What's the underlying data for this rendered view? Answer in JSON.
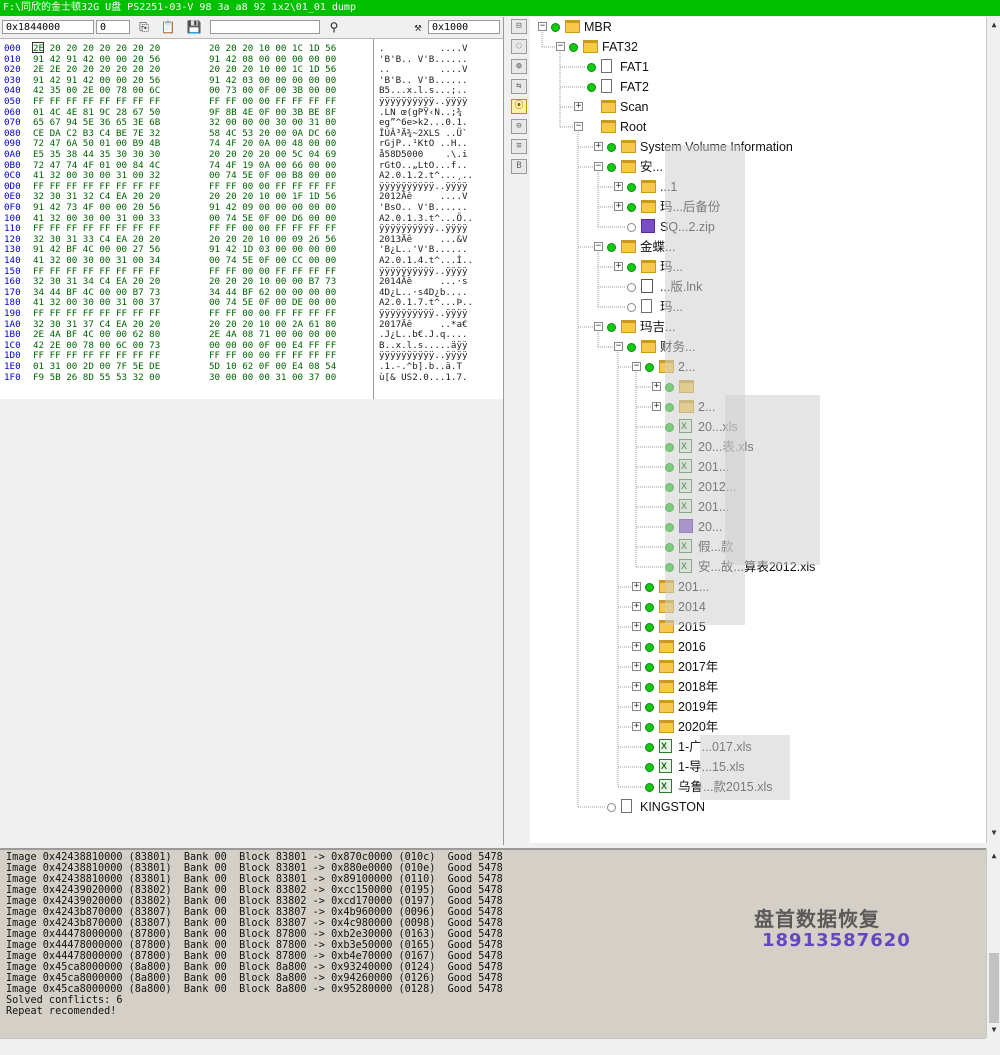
{
  "window": {
    "title": "F:\\同欣的金士顿32G U盘 PS2251-03-V   98 3a a8 92   1x2\\01_01 dump"
  },
  "toolbar": {
    "address": "0x1844000",
    "offset_value": "0",
    "copy_icon": "copy-icon",
    "paste_icon": "paste-icon",
    "save_icon": "save-icon",
    "find_icon": "binoculars-icon",
    "tools_icon": "tools-icon",
    "jump_value": "0x1000"
  },
  "hex": {
    "rows": [
      {
        "off": "000",
        "b1": "2E 20 20 20 20 20 20 20",
        "b2": "20 20 20 10 00 1C 1D 56",
        "asc": ".          ....V"
      },
      {
        "off": "010",
        "b1": "91 42 91 42 00 00 20 56",
        "b2": "91 42 08 00 00 00 00 00",
        "asc": "'B'B.. V'B......"
      },
      {
        "off": "020",
        "b1": "2E 2E 20 20 20 20 20 20",
        "b2": "20 20 20 10 00 1C 1D 56",
        "asc": "..         ....V"
      },
      {
        "off": "030",
        "b1": "91 42 91 42 00 00 20 56",
        "b2": "91 42 03 00 00 00 00 00",
        "asc": "'B'B.. V'B......"
      },
      {
        "off": "040",
        "b1": "42 35 00 2E 00 78 00 6C",
        "b2": "00 73 00 0F 00 3B 00 00",
        "asc": "B5...x.l.s...;.."
      },
      {
        "off": "050",
        "b1": "FF FF FF FF FF FF FF FF",
        "b2": "FF FF 00 00 FF FF FF FF",
        "asc": "ÿÿÿÿÿÿÿÿÿÿ..ÿÿÿÿ"
      },
      {
        "off": "060",
        "b1": "01 4C 4E 81 9C 28 67 50",
        "b2": "9F 8B 4E 0F 00 3B BE 8F",
        "asc": ".LN œ(gPŸ‹N..;¾"
      },
      {
        "off": "070",
        "b1": "65 67 94 5E 36 65 3E 6B",
        "b2": "32 00 00 00 30 00 31 00",
        "asc": "eg”^6e>k2...0.1."
      },
      {
        "off": "080",
        "b1": "CE DA C2 B3 C4 BE 7E 32",
        "b2": "58 4C 53 20 00 0A DC 60",
        "asc": "ÎÚÂ³Ä¾~2XLS ..Ü`"
      },
      {
        "off": "090",
        "b1": "72 47 6A 50 01 00 B9 4B",
        "b2": "74 4F 20 0A 00 48 00 00",
        "asc": "rGjP..¹KtO ..H.."
      },
      {
        "off": "0A0",
        "b1": "E5 35 38 44 35 30 30 30",
        "b2": "20 20 20 20 00 5C 04 69",
        "asc": "å58D5000    .\\.i"
      },
      {
        "off": "0B0",
        "b1": "72 47 74 4F 01 00 84 4C",
        "b2": "74 4F 19 0A 00 66 00 00",
        "asc": "rGtO..„LtO...f.."
      },
      {
        "off": "0C0",
        "b1": "41 32 00 30 00 31 00 32",
        "b2": "00 74 5E 0F 00 B8 00 00",
        "asc": "A2.0.1.2.t^...¸.."
      },
      {
        "off": "0D0",
        "b1": "FF FF FF FF FF FF FF FF",
        "b2": "FF FF 00 00 FF FF FF FF",
        "asc": "ÿÿÿÿÿÿÿÿÿÿ..ÿÿÿÿ"
      },
      {
        "off": "0E0",
        "b1": "32 30 31 32 C4 EA 20 20",
        "b2": "20 20 20 10 00 1F 1D 56",
        "asc": "2012Äê     ....V"
      },
      {
        "off": "0F0",
        "b1": "91 42 73 4F 00 00 20 56",
        "b2": "91 42 09 00 00 00 00 00",
        "asc": "'BsO.. V'B......"
      },
      {
        "off": "100",
        "b1": "41 32 00 30 00 31 00 33",
        "b2": "00 74 5E 0F 00 D6 00 00",
        "asc": "A2.0.1.3.t^...Ö.."
      },
      {
        "off": "110",
        "b1": "FF FF FF FF FF FF FF FF",
        "b2": "FF FF 00 00 FF FF FF FF",
        "asc": "ÿÿÿÿÿÿÿÿÿÿ..ÿÿÿÿ"
      },
      {
        "off": "120",
        "b1": "32 30 31 33 C4 EA 20 20",
        "b2": "20 20 20 10 00 09 26 56",
        "asc": "2013Äê     ...&V"
      },
      {
        "off": "130",
        "b1": "91 42 BF 4C 00 00 27 56",
        "b2": "91 42 1D 03 00 00 00 00",
        "asc": "'B¿L..'V'B......"
      },
      {
        "off": "140",
        "b1": "41 32 00 30 00 31 00 34",
        "b2": "00 74 5E 0F 00 CC 00 00",
        "asc": "A2.0.1.4.t^...Ì.."
      },
      {
        "off": "150",
        "b1": "FF FF FF FF FF FF FF FF",
        "b2": "FF FF 00 00 FF FF FF FF",
        "asc": "ÿÿÿÿÿÿÿÿÿÿ..ÿÿÿÿ"
      },
      {
        "off": "160",
        "b1": "32 30 31 34 C4 EA 20 20",
        "b2": "20 20 20 10 00 00 B7 73",
        "asc": "2014Äê     ...·s"
      },
      {
        "off": "170",
        "b1": "34 44 BF 4C 00 00 B7 73",
        "b2": "34 44 BF 62 00 00 00 00",
        "asc": "4D¿L..·s4D¿b...."
      },
      {
        "off": "180",
        "b1": "41 32 00 30 00 31 00 37",
        "b2": "00 74 5E 0F 00 DE 00 00",
        "asc": "A2.0.1.7.t^...Þ.."
      },
      {
        "off": "190",
        "b1": "FF FF FF FF FF FF FF FF",
        "b2": "FF FF 00 00 FF FF FF FF",
        "asc": "ÿÿÿÿÿÿÿÿÿÿ..ÿÿÿÿ"
      },
      {
        "off": "1A0",
        "b1": "32 30 31 37 C4 EA 20 20",
        "b2": "20 20 20 10 00 2A 61 80",
        "asc": "2017Äê     ..*a€"
      },
      {
        "off": "1B0",
        "b1": "2E 4A BF 4C 00 00 62 80",
        "b2": "2E 4A 08 71 00 00 00 00",
        "asc": ".J¿L..b€.J.q...."
      },
      {
        "off": "1C0",
        "b1": "42 2E 00 78 00 6C 00 73",
        "b2": "00 00 00 0F 00 E4 FF FF",
        "asc": "B..x.l.s.....äÿÿ"
      },
      {
        "off": "1D0",
        "b1": "FF FF FF FF FF FF FF FF",
        "b2": "FF FF 00 00 FF FF FF FF",
        "asc": "ÿÿÿÿÿÿÿÿÿÿ..ÿÿÿÿ"
      },
      {
        "off": "1E0",
        "b1": "01 31 00 2D 00 7F 5E DE",
        "b2": "5D 10 62 0F 00 E4 08 54",
        "asc": ".1.-.^b].b..ä.T"
      },
      {
        "off": "1F0",
        "b1": "F9 5B 26 8D 55 53 32 00",
        "b2": "30 00 00 00 31 00 37 00",
        "asc": "ù[& US2.0...1.7."
      }
    ]
  },
  "side_buttons": [
    "tool-a",
    "tool-b",
    "tool-c",
    "tool-d",
    "tool-e",
    "tool-f",
    "tool-g",
    "tool-h",
    "tool-i"
  ],
  "tree": {
    "nodes": [
      {
        "label": "MBR",
        "type": "folder",
        "depth": 0,
        "exp": "−",
        "dot": "green"
      },
      {
        "label": "FAT32",
        "type": "folder",
        "depth": 1,
        "exp": "−",
        "dot": "green"
      },
      {
        "label": "FAT1",
        "type": "file",
        "depth": 2,
        "exp": "",
        "dot": "green"
      },
      {
        "label": "FAT2",
        "type": "file",
        "depth": 2,
        "exp": "",
        "dot": "green"
      },
      {
        "label": "Scan",
        "type": "folder",
        "depth": 2,
        "exp": "+",
        "dot": ""
      },
      {
        "label": "Root",
        "type": "folder",
        "depth": 2,
        "exp": "−",
        "dot": ""
      },
      {
        "label": "System Volume Information",
        "type": "folder",
        "depth": 3,
        "exp": "+",
        "dot": "green"
      },
      {
        "label": "安...",
        "type": "folder",
        "depth": 3,
        "exp": "−",
        "dot": "green"
      },
      {
        "label": "...1",
        "type": "folder",
        "depth": 4,
        "exp": "+",
        "dot": "green"
      },
      {
        "label": "玛...后备份",
        "type": "folder",
        "depth": 4,
        "exp": "+",
        "dot": "green"
      },
      {
        "label": "SQ...2.zip",
        "type": "zip",
        "depth": 4,
        "exp": "",
        "dot": "gray"
      },
      {
        "label": "金蝶...",
        "type": "folder",
        "depth": 3,
        "exp": "−",
        "dot": "green"
      },
      {
        "label": "玛...",
        "type": "folder",
        "depth": 4,
        "exp": "+",
        "dot": "green"
      },
      {
        "label": "...版.lnk",
        "type": "lnk",
        "depth": 4,
        "exp": "",
        "dot": "gray"
      },
      {
        "label": "玛...",
        "type": "file",
        "depth": 4,
        "exp": "",
        "dot": "gray"
      },
      {
        "label": "玛吉...",
        "type": "folder",
        "depth": 3,
        "exp": "−",
        "dot": "green"
      },
      {
        "label": "财务...",
        "type": "folder",
        "depth": 4,
        "exp": "−",
        "dot": "green"
      },
      {
        "label": "2...",
        "type": "folder",
        "depth": 5,
        "exp": "−",
        "dot": "green"
      },
      {
        "label": "",
        "type": "folder",
        "depth": 6,
        "exp": "+",
        "dot": "green"
      },
      {
        "label": "2...",
        "type": "folder",
        "depth": 6,
        "exp": "+",
        "dot": "green"
      },
      {
        "label": "20...xls",
        "type": "xls",
        "depth": 6,
        "exp": "",
        "dot": "green"
      },
      {
        "label": "20...表.xls",
        "type": "xls",
        "depth": 6,
        "exp": "",
        "dot": "green"
      },
      {
        "label": "201...",
        "type": "xls",
        "depth": 6,
        "exp": "",
        "dot": "green"
      },
      {
        "label": "2012...",
        "type": "xls",
        "depth": 6,
        "exp": "",
        "dot": "green"
      },
      {
        "label": "201...",
        "type": "xls",
        "depth": 6,
        "exp": "",
        "dot": "green"
      },
      {
        "label": "20...",
        "type": "zip",
        "depth": 6,
        "exp": "",
        "dot": "green"
      },
      {
        "label": "假...款",
        "type": "xls",
        "depth": 6,
        "exp": "",
        "dot": "green"
      },
      {
        "label": "安...故...算表2012.xls",
        "type": "xls",
        "depth": 6,
        "exp": "",
        "dot": "green"
      },
      {
        "label": "201...",
        "type": "folder",
        "depth": 5,
        "exp": "+",
        "dot": "green"
      },
      {
        "label": "2014",
        "type": "folder",
        "depth": 5,
        "exp": "+",
        "dot": "green"
      },
      {
        "label": "2015",
        "type": "folder",
        "depth": 5,
        "exp": "+",
        "dot": "green"
      },
      {
        "label": "2016",
        "type": "folder",
        "depth": 5,
        "exp": "+",
        "dot": "green"
      },
      {
        "label": "2017年",
        "type": "folder",
        "depth": 5,
        "exp": "+",
        "dot": "green"
      },
      {
        "label": "2018年",
        "type": "folder",
        "depth": 5,
        "exp": "+",
        "dot": "green"
      },
      {
        "label": "2019年",
        "type": "folder",
        "depth": 5,
        "exp": "+",
        "dot": "green"
      },
      {
        "label": "2020年",
        "type": "folder",
        "depth": 5,
        "exp": "+",
        "dot": "green"
      },
      {
        "label": "1-广...017.xls",
        "type": "xls",
        "depth": 5,
        "exp": "",
        "dot": "green"
      },
      {
        "label": "1-导...15.xls",
        "type": "xls",
        "depth": 5,
        "exp": "",
        "dot": "green"
      },
      {
        "label": "乌鲁...款2015.xls",
        "type": "xls",
        "depth": 5,
        "exp": "",
        "dot": "green"
      },
      {
        "label": "KINGSTON",
        "type": "file",
        "depth": 3,
        "exp": "",
        "dot": "gray"
      }
    ]
  },
  "log": {
    "lines": [
      "Image 0x42438810000 (83801)  Bank 00  Block 83801 -> 0x870c0000 (010c)  Good 5478",
      "Image 0x42438810000 (83801)  Bank 00  Block 83801 -> 0x880e0000 (010e)  Good 5478",
      "Image 0x42438810000 (83801)  Bank 00  Block 83801 -> 0x89100000 (0110)  Good 5478",
      "Image 0x42439020000 (83802)  Bank 00  Block 83802 -> 0xcc150000 (0195)  Good 5478",
      "Image 0x42439020000 (83802)  Bank 00  Block 83802 -> 0xcd170000 (0197)  Good 5478",
      "Image 0x4243b870000 (83807)  Bank 00  Block 83807 -> 0x4b960000 (0096)  Good 5478",
      "Image 0x4243b870000 (83807)  Bank 00  Block 83807 -> 0x4c980000 (0098)  Good 5478",
      "Image 0x44478000000 (87800)  Bank 00  Block 87800 -> 0xb2e30000 (0163)  Good 5478",
      "Image 0x44478000000 (87800)  Bank 00  Block 87800 -> 0xb3e50000 (0165)  Good 5478",
      "Image 0x44478000000 (87800)  Bank 00  Block 87800 -> 0xb4e70000 (0167)  Good 5478",
      "Image 0x45ca8000000 (8a800)  Bank 00  Block 8a800 -> 0x93240000 (0124)  Good 5478",
      "Image 0x45ca8000000 (8a800)  Bank 00  Block 8a800 -> 0x94260000 (0126)  Good 5478",
      "Image 0x45ca8000000 (8a800)  Bank 00  Block 8a800 -> 0x95280000 (0128)  Good 5478",
      "Solved conflicts: 6",
      "Repeat recomended!"
    ]
  },
  "watermark": {
    "line1": "盘首数据恢复",
    "line2": "18913587620"
  }
}
